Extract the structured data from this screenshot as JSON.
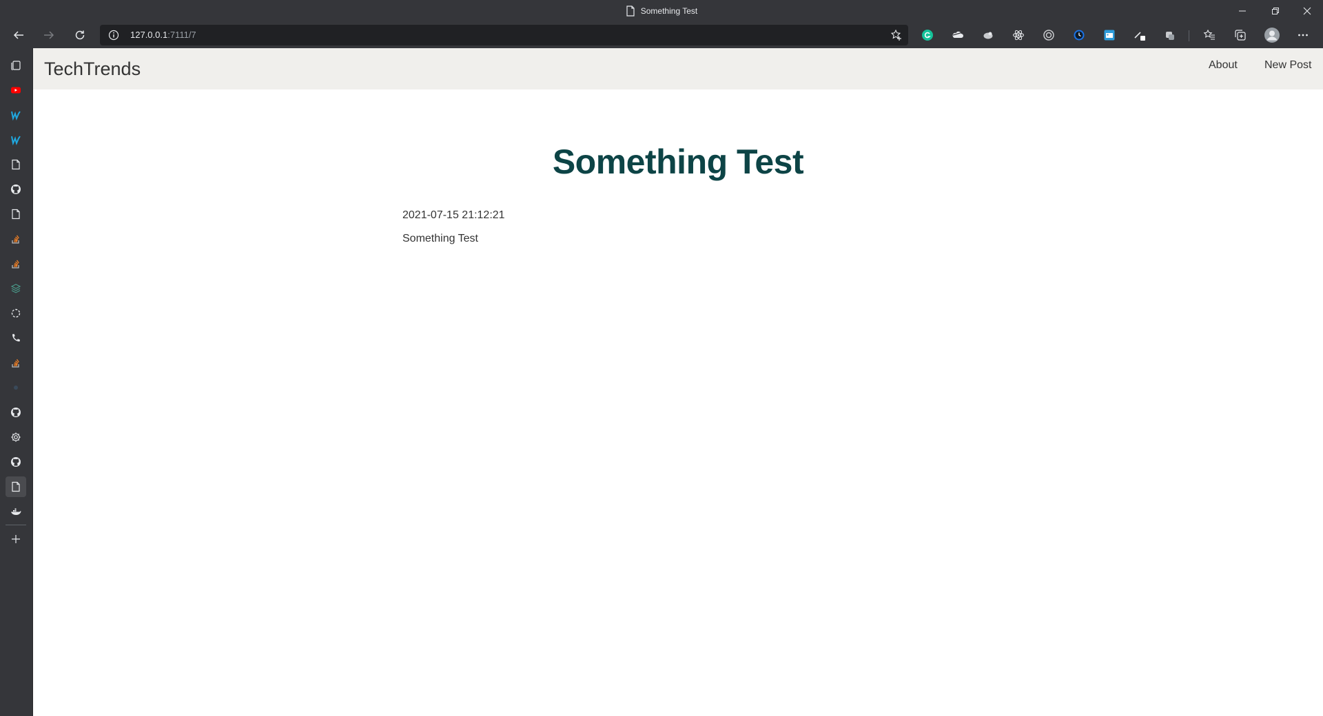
{
  "browser": {
    "tab_title": "Something Test",
    "address": {
      "host": "127.0.0.1",
      "path": ":7111/7"
    },
    "extensions": [
      "grammarly-icon",
      "cloud-extension-icon",
      "bird-extension-icon",
      "react-devtools-icon",
      "target-extension-icon",
      "clock-extension-icon",
      "calendar-extension-icon",
      "pen-extension-icon",
      "puzzle-extension-icon"
    ],
    "sidebar_icons": [
      "collections-icon",
      "youtube-icon",
      "webflow-icon",
      "webflow-icon",
      "page-icon",
      "github-icon",
      "page-icon",
      "stackoverflow-icon",
      "stackoverflow-icon",
      "stack-icon",
      "loader-icon",
      "phone-icon",
      "stackoverflow-icon",
      "dot-icon",
      "github-icon",
      "gear-icon",
      "github-icon",
      "page-icon",
      "docker-icon"
    ]
  },
  "site": {
    "brand": "TechTrends",
    "nav": {
      "about": "About",
      "new_post": "New Post"
    }
  },
  "post": {
    "title": "Something Test",
    "created": "2021-07-15 21:12:21",
    "content": "Something Test"
  },
  "colors": {
    "chrome_bg": "#35363a",
    "address_bg": "#202124",
    "nav_bg": "#f0efec",
    "title_color": "#0d4446"
  }
}
